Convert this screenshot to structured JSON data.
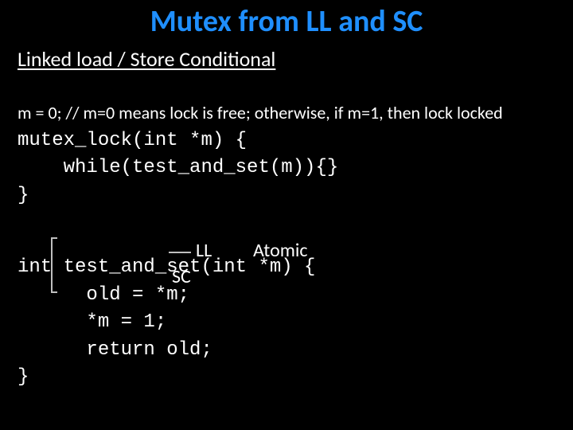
{
  "title": "Mutex from LL and SC",
  "subtitle": "Linked load / Store Conditional",
  "code": {
    "l1": "m = 0; // m=0 means lock is free; otherwise, if m=1, then lock locked",
    "l2": "mutex_lock(int *m) {",
    "l3": "    while(test_and_set(m)){}",
    "l4": "}",
    "l5": "int test_and_set(int *m) {",
    "l6": "      old = *m;",
    "l7": "      *m = 1;",
    "l8": "      return old;",
    "l9": "}"
  },
  "annot": {
    "ll": "LL",
    "sc": "SC",
    "atomic": "Atomic"
  }
}
